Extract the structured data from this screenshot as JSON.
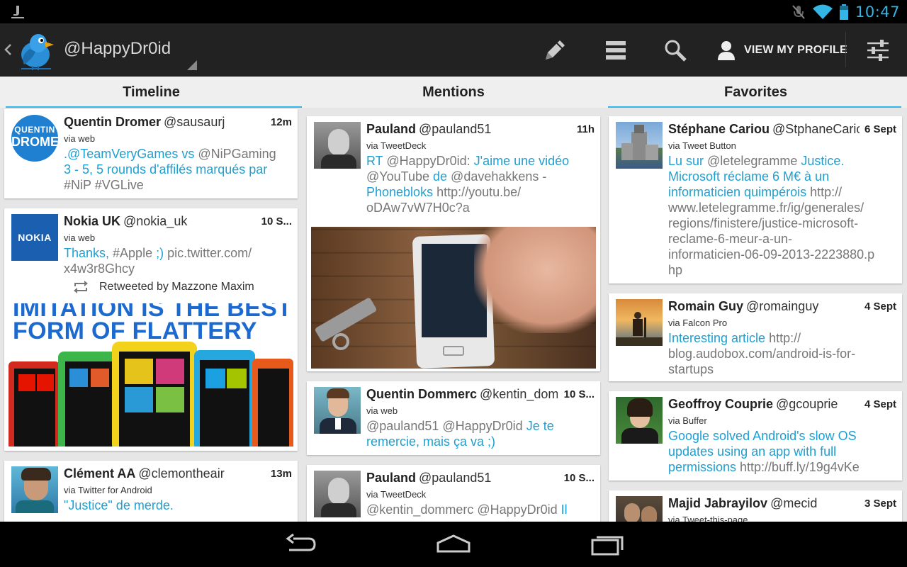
{
  "status_bar": {
    "clock": "10:47",
    "icons": [
      "notification-icon",
      "mute-icon",
      "wifi-icon",
      "battery-icon"
    ],
    "accent": "#33b5e5"
  },
  "action_bar": {
    "account": "@HappyDr0id",
    "profile_label": "VIEW MY PROFILE",
    "icons": [
      "back-chevron-icon",
      "bird-logo-icon",
      "compose-icon",
      "list-icon",
      "search-icon",
      "user-icon",
      "filter-icon"
    ]
  },
  "tabs": [
    {
      "label": "Timeline"
    },
    {
      "label": "Mentions"
    },
    {
      "label": "Favorites"
    }
  ],
  "timeline": [
    {
      "name": "Quentin Dromer",
      "handle": "@sausaurj",
      "time": "12m",
      "via": "via web",
      "text_parts": [
        ".@TeamVeryGames vs",
        " @NiPGaming",
        " 3 - 5, 5 rounds d'affilés marqués par",
        " #NiP #VGLive"
      ],
      "avatar_text": [
        "QUENTIN",
        "DROMER"
      ]
    },
    {
      "name": "Nokia UK",
      "handle": "@nokia_uk",
      "time": "10 S...",
      "via": "via web",
      "text_parts": [
        "Thanks,",
        " #Apple",
        " ;)",
        " pic.twitter.com/",
        "x4w3r8Ghcy"
      ],
      "avatar_text": "NOKIA",
      "retweet": "Retweeted by Mazzone Maxim",
      "media_lines": [
        "IMITATION IS THE BEST",
        "FORM OF FLATTERY"
      ]
    },
    {
      "name": "Clément AA",
      "handle": "@clemontheair",
      "time": "13m",
      "via": "via Twitter for Android",
      "text_parts": [
        "\"Justice\" de merde."
      ]
    }
  ],
  "mentions": [
    {
      "name": "Pauland",
      "handle": "@pauland51",
      "time": "11h",
      "via": "via TweetDeck",
      "text_parts": [
        "RT",
        " @HappyDr0id:",
        " J'aime une vidéo",
        "@YouTube",
        " de",
        " @davehakkens",
        " -",
        "Phonebloks",
        " http://youtu.be/",
        "oDAw7vW7H0c?a"
      ]
    },
    {
      "name": "Quentin Dommerc",
      "handle": "@kentin_dommerc",
      "time": "10 S...",
      "via": "via web",
      "text_parts": [
        "@pauland51 @HappyDr0id",
        " Je te",
        " remercie, mais ça va ;)"
      ]
    },
    {
      "name": "Pauland",
      "handle": "@pauland51",
      "time": "10 S...",
      "via": "via TweetDeck",
      "text_parts": [
        "@kentin_dommerc @HappyDr0id",
        " Il"
      ]
    }
  ],
  "favorites": [
    {
      "name": "Stéphane Cariou",
      "handle": "@StphaneCariou",
      "time": "6 Sept",
      "via": "via Tweet Button",
      "text_parts": [
        "Lu sur",
        " @letelegramme",
        " Justice.",
        "Microsoft réclame 6 M€ à un",
        "informaticien quimpérois",
        " http://",
        "www.letelegramme.fr/ig/generales/",
        "regions/finistere/justice-microsoft-",
        "reclame-6-meur-a-un-",
        "informaticien-06-09-2013-2223880.p",
        "hp"
      ]
    },
    {
      "name": "Romain Guy",
      "handle": "@romainguy",
      "time": "4 Sept",
      "via": "via Falcon Pro",
      "text_parts": [
        "Interesting article",
        " http://",
        "blog.audobox.com/android-is-for-",
        "startups"
      ]
    },
    {
      "name": "Geoffroy Couprie",
      "handle": "@gcouprie",
      "time": "4 Sept",
      "via": "via Buffer",
      "text_parts": [
        "Google solved Android's slow OS",
        "updates using an app with full",
        "permissions",
        " http://buff.ly/19g4vKe"
      ]
    },
    {
      "name": "Majid Jabrayilov",
      "handle": "@mecid",
      "time": "3 Sept",
      "via": "via Tweet-this-page",
      "text_parts": []
    }
  ],
  "nav_bar": {
    "icons": [
      "back-icon",
      "home-icon",
      "recent-apps-icon"
    ]
  }
}
